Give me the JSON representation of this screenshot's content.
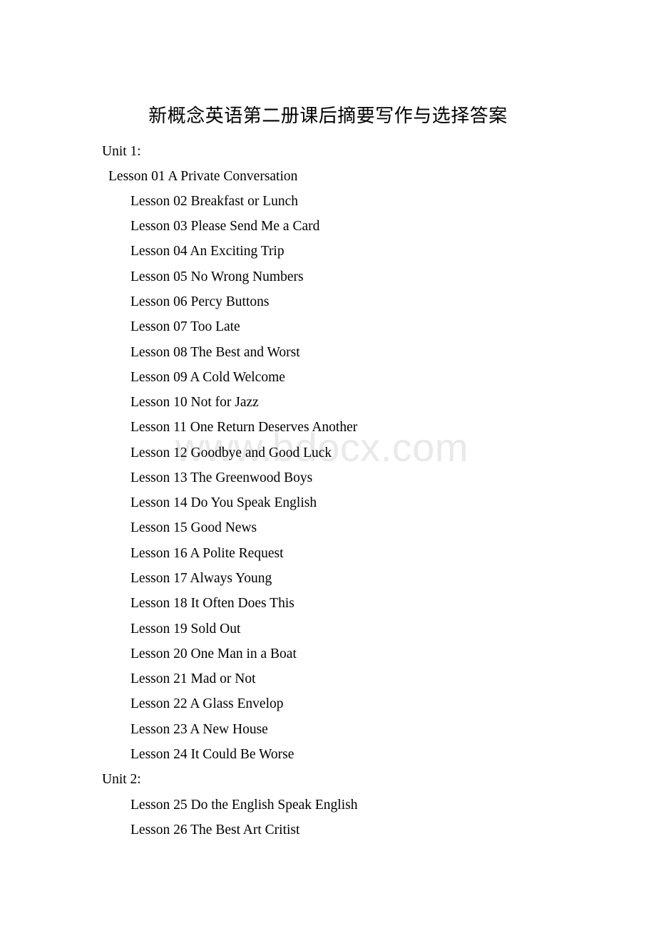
{
  "document": {
    "title": "新概念英语第二册课后摘要写作与选择答案",
    "watermark": "www.bdocx.com",
    "units": [
      {
        "label": "Unit 1:",
        "lessons": [
          "Lesson 01 A Private Conversation",
          "Lesson 02 Breakfast or Lunch",
          "Lesson 03 Please Send Me a Card",
          "Lesson 04 An Exciting Trip",
          "Lesson 05 No Wrong Numbers",
          "Lesson 06 Percy Buttons",
          "Lesson 07 Too Late",
          "Lesson 08 The Best and Worst",
          "Lesson 09 A Cold Welcome",
          "Lesson 10 Not for Jazz",
          "Lesson 11 One Return Deserves Another",
          "Lesson 12 Goodbye and Good Luck",
          "Lesson 13 The Greenwood Boys",
          "Lesson 14 Do You Speak English",
          "Lesson 15 Good News",
          "Lesson 16 A Polite Request",
          "Lesson 17 Always Young",
          "Lesson 18 It Often Does This",
          "Lesson 19 Sold Out",
          "Lesson 20 One Man in a Boat",
          "Lesson 21 Mad or Not",
          "Lesson 22 A Glass Envelop",
          "Lesson 23 A New House",
          "Lesson 24 It Could Be Worse"
        ]
      },
      {
        "label": "Unit 2:",
        "lessons": [
          "Lesson 25 Do the English Speak English",
          "Lesson 26 The Best Art Critist"
        ]
      }
    ]
  }
}
